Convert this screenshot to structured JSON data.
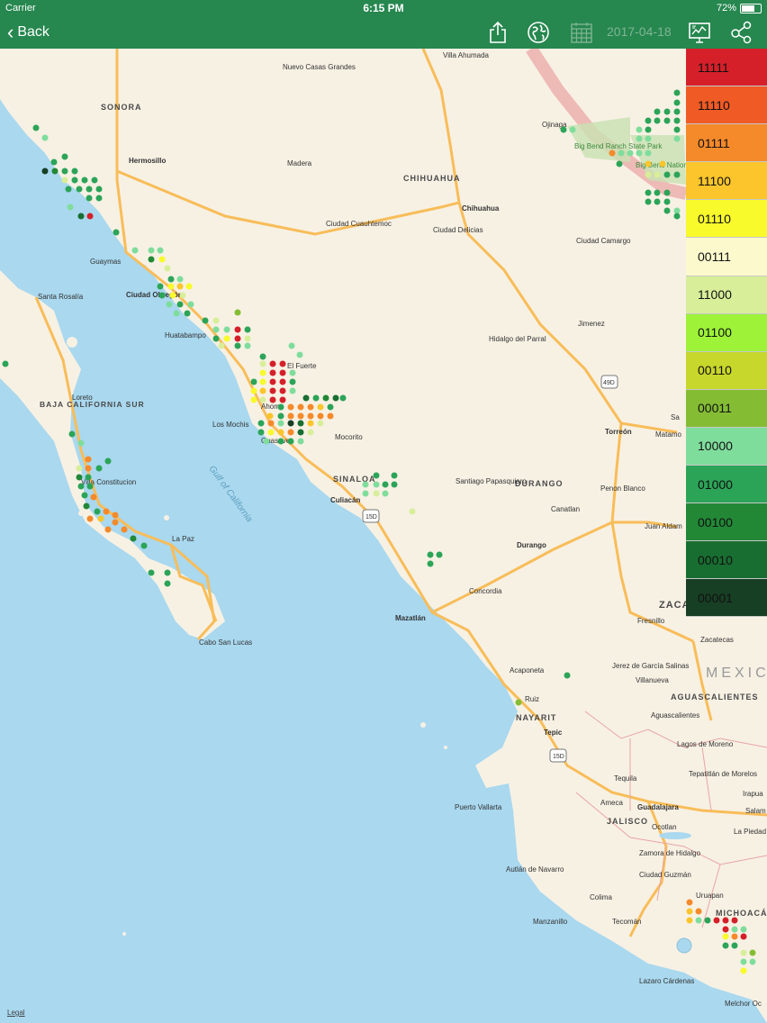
{
  "status": {
    "carrier": "Carrier",
    "time": "6:15 PM",
    "battery": "72%"
  },
  "nav": {
    "back_label": "Back",
    "date": "2017-04-18"
  },
  "legend": [
    {
      "label": "11111",
      "color": "#d5202a"
    },
    {
      "label": "11110",
      "color": "#ef5a25"
    },
    {
      "label": "01111",
      "color": "#f58a2a"
    },
    {
      "label": "11100",
      "color": "#fbc52b"
    },
    {
      "label": "01110",
      "color": "#f8fa2c"
    },
    {
      "label": "00111",
      "color": "#fcf9cd"
    },
    {
      "label": "11000",
      "color": "#d8ee99"
    },
    {
      "label": "01100",
      "color": "#9ef338"
    },
    {
      "label": "00110",
      "color": "#c8d72b"
    },
    {
      "label": "00011",
      "color": "#84bd34"
    },
    {
      "label": "10000",
      "color": "#7fdd9c"
    },
    {
      "label": "01000",
      "color": "#2ca458"
    },
    {
      "label": "00100",
      "color": "#228836"
    },
    {
      "label": "00010",
      "color": "#186e31"
    },
    {
      "label": "00001",
      "color": "#173f24"
    }
  ],
  "map": {
    "states": [
      "SONORA",
      "CHIHUAHUA",
      "BAJA CALIFORNIA SUR",
      "SINALOA",
      "DURANGO",
      "NAYARIT",
      "JALISCO",
      "AGUASCALIENTES",
      "MICHOACÁ",
      "ZACA",
      "MEXIC"
    ],
    "sea_label": "Gulf of California",
    "highway_labels": [
      "49D",
      "15D",
      "15D"
    ],
    "legal": "Legal",
    "places": [
      "Villa Ahumada",
      "Nuevo Casas Grandes",
      "Ojinaga",
      "Big Bend Ranch State Park",
      "Big Bend National Park",
      "Hermosillo",
      "Madera",
      "Chihuahua",
      "Ciudad Cuauhtemoc",
      "Ciudad Delicias",
      "Ciudad Camargo",
      "Guaymas",
      "Ciudad Obregón",
      "Santa Rosalía",
      "Huatabampo",
      "Jimenez",
      "Hidalgo del Parral",
      "El Fuerte",
      "Loreto",
      "Ahome",
      "Los Mochis",
      "Guasave",
      "Mocorito",
      "Torreón",
      "Matamo",
      "Sa",
      "Villa Constitucion",
      "Santiago Papasquiaro",
      "Culiacán",
      "Penon Blanco",
      "Canatlan",
      "Juan Aldam",
      "La Paz",
      "Durango",
      "Concordia",
      "Fresnillo",
      "Mazatlán",
      "Zacatecas",
      "Cabo San Lucas",
      "Jerez de García Salinas",
      "Villanueva",
      "Acaponeta",
      "Ruiz",
      "Aguascalientes",
      "Tepic",
      "Lagos de Moreno",
      "Tepatitlán de Morelos",
      "Tequila",
      "Puerto Vallarta",
      "Ameca",
      "Guadalajara",
      "Irapua",
      "Salam",
      "Ocotlan",
      "La Piedad",
      "Zamora de Hidalgo",
      "Autlán de Navarro",
      "Ciudad Guzmán",
      "Uruapan",
      "Colima",
      "Manzanillo",
      "Tecomán",
      "Lazaro Cárdenas",
      "Melchor Oc"
    ]
  }
}
